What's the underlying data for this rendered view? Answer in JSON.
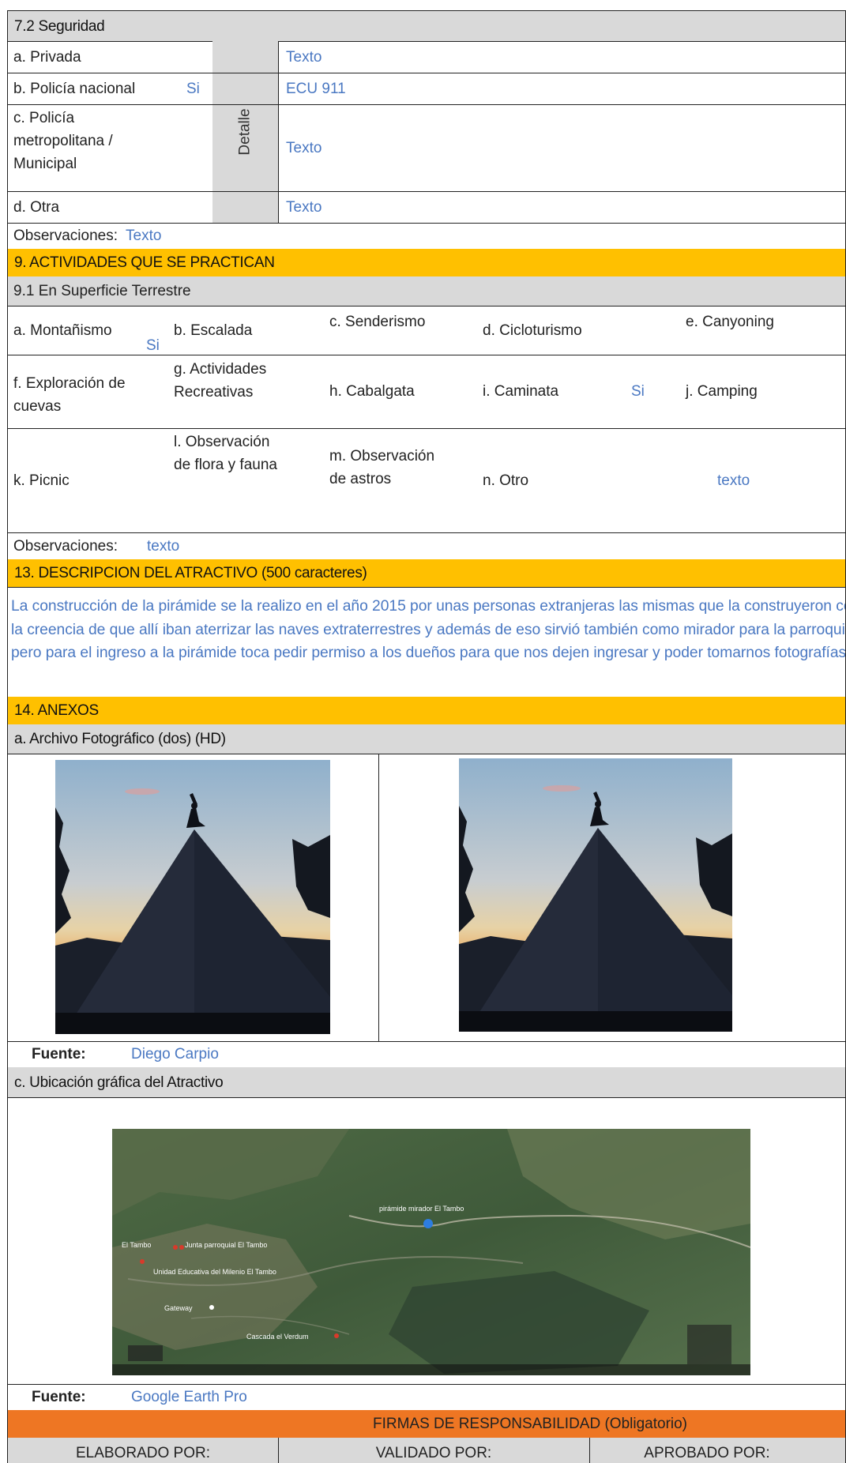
{
  "seguridad": {
    "title": "7.2 Seguridad",
    "detalle_label": "Detalle",
    "rows": [
      {
        "label": "a. Privada",
        "value": "",
        "detail": "Texto"
      },
      {
        "label": "b. Policía nacional",
        "value": "Si",
        "detail": "ECU 911"
      },
      {
        "label": "c. Policía metropolitana / Municipal",
        "value": "",
        "detail": "Texto"
      },
      {
        "label": "d. Otra",
        "value": "",
        "detail": "Texto"
      }
    ],
    "obs_label": "Observaciones:",
    "obs_value": "Texto"
  },
  "actividades": {
    "title": "9. ACTIVIDADES QUE SE PRACTICAN",
    "subtitle": "9.1 En Superficie Terrestre",
    "items": {
      "a": {
        "label": "a. Montañismo",
        "value": "Si"
      },
      "b": {
        "label": "b. Escalada",
        "value": ""
      },
      "c": {
        "label": "c. Senderismo",
        "value": ""
      },
      "d": {
        "label": "d. Cicloturismo",
        "value": ""
      },
      "e": {
        "label": "e. Canyoning",
        "value": ""
      },
      "f": {
        "label": "f.  Exploración de cuevas",
        "value": ""
      },
      "g": {
        "label": "g. Actividades Recreativas",
        "value": ""
      },
      "h": {
        "label": "h. Cabalgata",
        "value": ""
      },
      "i": {
        "label": "i. Caminata",
        "value": "Si"
      },
      "j": {
        "label": "j. Camping",
        "value": ""
      },
      "k": {
        "label": "k. Picnic",
        "value": ""
      },
      "l": {
        "label": "l. Observación de flora y fauna",
        "value": ""
      },
      "m": {
        "label": "m. Observación de astros",
        "value": ""
      },
      "n": {
        "label": "n. Otro",
        "value": "texto"
      }
    },
    "obs_label": "Observaciones:",
    "obs_value": "texto"
  },
  "descripcion": {
    "title": "13. DESCRIPCION DEL ATRACTIVO (500 caracteres)",
    "text": " La construcción de la pirámide se la realizo en el año 2015 por unas personas extranjeras las mismas que la construyeron con la creencia de que allí iban  aterrizar las naves extraterrestres y además de eso sirvió también como mirador para la parroquia pero para el ingreso a la pirámide toca pedir permiso a los dueños para que nos dejen ingresar y poder tomarnos fotografías."
  },
  "anexos": {
    "title": "14. ANEXOS",
    "foto_title": "a. Archivo Fotográfico (dos) (HD)",
    "fuente_label": "Fuente:",
    "fuente_foto": "Diego Carpio",
    "ubicacion_title": "c. Ubicación gráfica del Atractivo",
    "fuente_mapa": "Google Earth Pro",
    "map_labels": {
      "pin": "pirámide mirador El Tambo",
      "town": "El Tambo",
      "junta": "Junta parroquial El Tambo",
      "unidad": "Unidad Educativa del Milenio El Tambo",
      "gateway": "Gateway",
      "cascada": "Cascada el Verdum"
    }
  },
  "firmas": {
    "title": "FIRMAS DE RESPONSABILIDAD (Obligatorio)",
    "elaborado": "ELABORADO POR:",
    "validado": "VALIDADO POR:",
    "aprobado": "APROBADO POR:"
  },
  "colors": {
    "section_header": "#ffc000",
    "sub_header": "#d9d9d9",
    "firmas_header": "#ee7623",
    "value_text": "#4a78c2"
  }
}
